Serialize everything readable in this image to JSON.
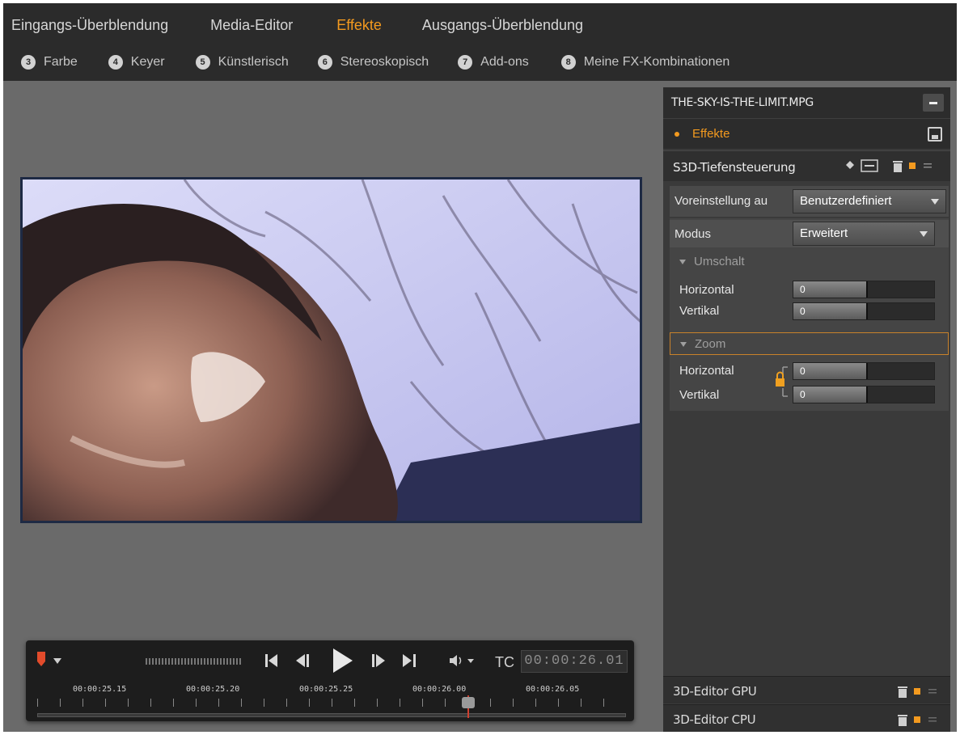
{
  "tabs_main": [
    "Eingangs-Überblendung",
    "Media-Editor",
    "Effekte",
    "Ausgangs-Überblendung"
  ],
  "tabs_main_active": "Effekte",
  "categories": [
    {
      "num": "3",
      "label": "Farbe"
    },
    {
      "num": "4",
      "label": "Keyer"
    },
    {
      "num": "5",
      "label": "Künstlerisch"
    },
    {
      "num": "6",
      "label": "Stereoskopisch"
    },
    {
      "num": "7",
      "label": "Add-ons"
    },
    {
      "num": "8",
      "label": "Meine FX-Kombinationen"
    }
  ],
  "panel": {
    "filename": "THE-SKY-IS-THE-LIMIT.MPG",
    "effects_label": "Effekte",
    "effect_name": "S3D-Tiefensteuerung",
    "preset_label": "Voreinstellung au",
    "preset_value": "Benutzerdefiniert",
    "mode_label": "Modus",
    "mode_value": "Erweitert",
    "section_shift": "Umschalt",
    "section_zoom": "Zoom",
    "shift_horizontal_label": "Horizontal",
    "shift_horizontal_value": "0",
    "shift_vertical_label": "Vertikal",
    "shift_vertical_value": "0",
    "zoom_horizontal_label": "Horizontal",
    "zoom_horizontal_value": "0",
    "zoom_vertical_label": "Vertikal",
    "zoom_vertical_value": "0",
    "other_effects": [
      "3D-Editor GPU",
      "3D-Editor CPU"
    ]
  },
  "transport": {
    "tc_label": "TC",
    "timecode": "00:00:26.01",
    "timeline_labels": [
      "00:00:25.15",
      "00:00:25.20",
      "00:00:25.25",
      "00:00:26.00",
      "00:00:26.05"
    ]
  },
  "colors": {
    "accent": "#f39a1f",
    "header_bg": "#2b2b2b",
    "panel_bg": "#3a3a3a",
    "workspace_bg": "#6a6a6a"
  },
  "icons": [
    "marker-icon",
    "skip-start-icon",
    "step-back-icon",
    "play-icon",
    "step-forward-icon",
    "skip-end-icon",
    "volume-icon",
    "save-icon",
    "lock-icon",
    "trash-icon",
    "keyframe-icon",
    "menu-icon"
  ]
}
